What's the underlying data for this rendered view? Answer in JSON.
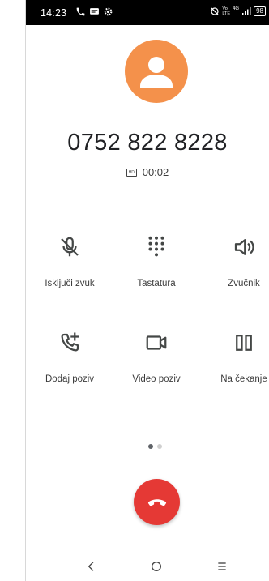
{
  "status_bar": {
    "time": "14:23",
    "left_icons": [
      "call-icon",
      "message-icon",
      "settings-gear-icon"
    ],
    "right_icons": [
      "mute-ring-icon",
      "volte-lte-icon",
      "signal-icon"
    ],
    "network_label_top": "Vo",
    "network_label_bottom": "LTE",
    "network_gen": "4G",
    "battery": "98"
  },
  "call": {
    "number": "0752 822 8228",
    "duration": "00:02",
    "hd_badge": "HD"
  },
  "controls": [
    {
      "label": "Isključi zvuk",
      "icon": "mic-off-icon"
    },
    {
      "label": "Tastatura",
      "icon": "dialpad-icon"
    },
    {
      "label": "Zvučnik",
      "icon": "speaker-icon"
    },
    {
      "label": "Dodaj poziv",
      "icon": "add-call-icon"
    },
    {
      "label": "Video poziv",
      "icon": "video-icon"
    },
    {
      "label": "Na čekanje",
      "icon": "pause-icon"
    }
  ],
  "pager": {
    "pages": 2,
    "active": 1
  },
  "end_call": {
    "icon": "end-call-icon",
    "color": "#e53935"
  },
  "nav_bar": {
    "items": [
      "back-icon",
      "home-icon",
      "recents-icon"
    ]
  },
  "colors": {
    "avatar": "#f4914b",
    "text": "#202124",
    "icon": "#444746"
  }
}
